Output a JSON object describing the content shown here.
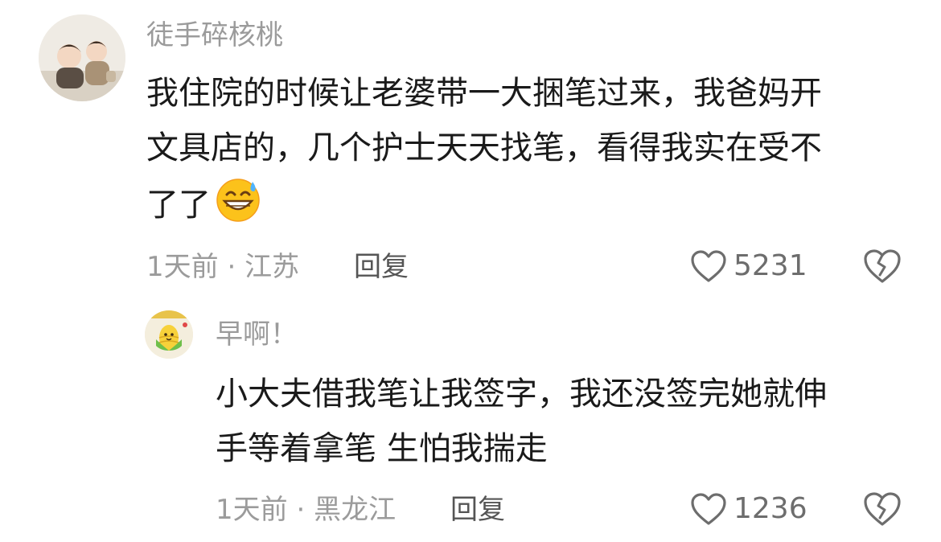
{
  "comment": {
    "username": "徒手碎核桃",
    "lines": [
      "我住院的时候让老婆带一大捆笔过来，我爸妈开",
      "文具店的，几个护士天天找笔，看得我实在受不",
      "了了"
    ],
    "emoji": "grinning-sweat-emoji",
    "time": "1天前",
    "separator": "·",
    "location": "江苏",
    "reply_label": "回复",
    "like_count": "5231"
  },
  "reply": {
    "username": "早啊！",
    "lines": [
      "小大夫借我笔让我签字，我还没签完她就伸",
      "手等着拿笔 生怕我揣走"
    ],
    "time": "1天前",
    "separator": "·",
    "location": "黑龙江",
    "reply_label": "回复",
    "like_count": "1236"
  },
  "icons": {
    "like": "heart-outline-icon",
    "dislike": "broken-heart-icon"
  },
  "colors": {
    "text": "#1a1a1a",
    "muted": "#9b9b9b",
    "icon": "#6d6d6d"
  }
}
